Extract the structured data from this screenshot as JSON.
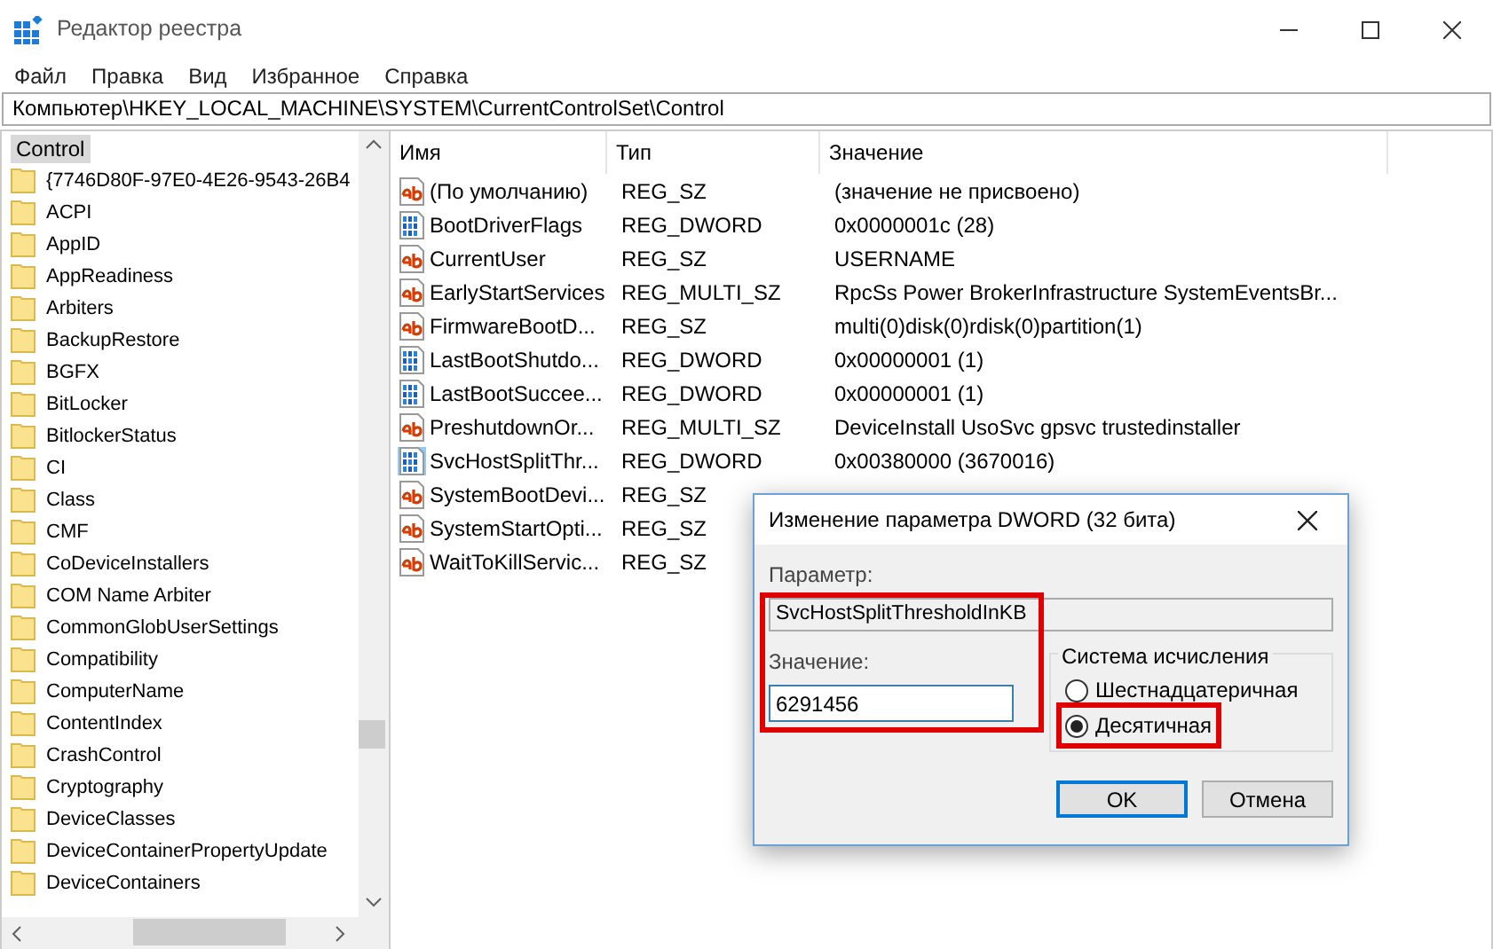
{
  "window": {
    "title": "Редактор реестра"
  },
  "menu": [
    "Файл",
    "Правка",
    "Вид",
    "Избранное",
    "Справка"
  ],
  "address": "Компьютер\\HKEY_LOCAL_MACHINE\\SYSTEM\\CurrentControlSet\\Control",
  "tree": {
    "root": {
      "label": "Control",
      "selected": true
    },
    "items": [
      "{7746D80F-97E0-4E26-9543-26B4",
      "ACPI",
      "AppID",
      "AppReadiness",
      "Arbiters",
      "BackupRestore",
      "BGFX",
      "BitLocker",
      "BitlockerStatus",
      "CI",
      "Class",
      "CMF",
      "CoDeviceInstallers",
      "COM Name Arbiter",
      "CommonGlobUserSettings",
      "Compatibility",
      "ComputerName",
      "ContentIndex",
      "CrashControl",
      "Cryptography",
      "DeviceClasses",
      "DeviceContainerPropertyUpdate",
      "DeviceContainers"
    ]
  },
  "table": {
    "columns": [
      "Имя",
      "Тип",
      "Значение"
    ],
    "rows": [
      {
        "kind": "string",
        "name": "(По умолчанию)",
        "type": "REG_SZ",
        "value": "(значение не присвоено)",
        "selected": false
      },
      {
        "kind": "binary",
        "name": "BootDriverFlags",
        "type": "REG_DWORD",
        "value": "0x0000001c (28)",
        "selected": false
      },
      {
        "kind": "string",
        "name": "CurrentUser",
        "type": "REG_SZ",
        "value": "USERNAME",
        "selected": false
      },
      {
        "kind": "string",
        "name": "EarlyStartServices",
        "type": "REG_MULTI_SZ",
        "value": "RpcSs Power BrokerInfrastructure SystemEventsBr...",
        "selected": false
      },
      {
        "kind": "string",
        "name": "FirmwareBootD...",
        "type": "REG_SZ",
        "value": "multi(0)disk(0)rdisk(0)partition(1)",
        "selected": false
      },
      {
        "kind": "binary",
        "name": "LastBootShutdo...",
        "type": "REG_DWORD",
        "value": "0x00000001 (1)",
        "selected": false
      },
      {
        "kind": "binary",
        "name": "LastBootSuccee...",
        "type": "REG_DWORD",
        "value": "0x00000001 (1)",
        "selected": false
      },
      {
        "kind": "string",
        "name": "PreshutdownOr...",
        "type": "REG_MULTI_SZ",
        "value": "DeviceInstall UsoSvc gpsvc trustedinstaller",
        "selected": false
      },
      {
        "kind": "binary",
        "name": "SvcHostSplitThr...",
        "type": "REG_DWORD",
        "value": "0x00380000 (3670016)",
        "selected": true
      },
      {
        "kind": "string",
        "name": "SystemBootDevi...",
        "type": "REG_SZ",
        "selected": false
      },
      {
        "kind": "string",
        "name": "SystemStartOpti...",
        "type": "REG_SZ",
        "selected": false
      },
      {
        "kind": "string",
        "name": "WaitToKillServic...",
        "type": "REG_SZ",
        "selected": false
      }
    ]
  },
  "dialog": {
    "title": "Изменение параметра DWORD (32 бита)",
    "param_label": "Параметр:",
    "param_value": "SvcHostSplitThresholdInKB",
    "value_label": "Значение:",
    "value": "6291456",
    "fields_highlighted": true,
    "base_group": "Система исчисления",
    "base_options": [
      {
        "label": "Шестнадцатеричная",
        "selected": false,
        "highlighted": false
      },
      {
        "label": "Десятичная",
        "selected": true,
        "highlighted": true
      }
    ],
    "buttons": [
      {
        "label": "OK",
        "default": true
      },
      {
        "label": "Отмена",
        "default": false
      }
    ]
  }
}
